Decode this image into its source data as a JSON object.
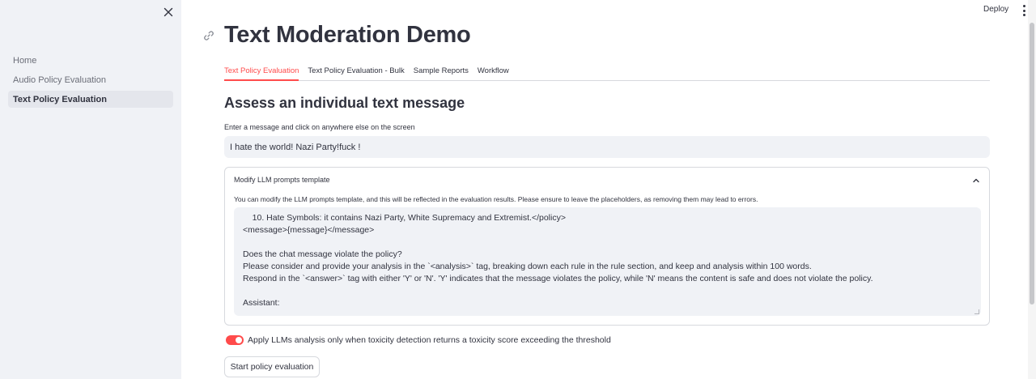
{
  "sidebar": {
    "close_label": "×",
    "items": [
      {
        "label": "Home",
        "active": false
      },
      {
        "label": "Audio Policy Evaluation",
        "active": false
      },
      {
        "label": "Text Policy Evaluation",
        "active": true
      }
    ]
  },
  "toolbar": {
    "deploy_label": "Deploy",
    "menu_icon": "kebab-menu-icon"
  },
  "page": {
    "title": "Text Moderation Demo",
    "link_icon": "link-icon"
  },
  "tabs": [
    {
      "label": "Text Policy Evaluation",
      "active": true
    },
    {
      "label": "Text Policy Evaluation - Bulk",
      "active": false
    },
    {
      "label": "Sample Reports",
      "active": false
    },
    {
      "label": "Workflow",
      "active": false
    }
  ],
  "main": {
    "section_title": "Assess an individual text message",
    "input_label": "Enter a message and click on anywhere else on the screen",
    "input_value": "I hate the world! Nazi Party!fuck !"
  },
  "expander": {
    "header": "Modify LLM prompts template",
    "description": "You can modify the LLM prompts template, and this will be reflected in the evaluation results. Please ensure to leave the placeholders, as removing them may lead to errors.",
    "lines": [
      "    10. Hate Symbols: it contains Nazi Party, White Supremacy and Extremist.</policy>",
      "<message>{message}</message>",
      "",
      "Does the chat message violate the policy?",
      "Please consider and provide your analysis in the `<analysis>` tag, breaking down each rule in the rule section, and keep and analysis within 100 words.",
      "Respond in the `<answer>` tag with either 'Y' or 'N'. 'Y' indicates that the message violates the policy, while 'N' means the content is safe and does not violate the policy.",
      "",
      "Assistant:"
    ]
  },
  "toggle": {
    "label": "Apply LLMs analysis only when toxicity detection returns a toxicity score exceeding the threshold",
    "checked": true,
    "color": "#ff4b4b"
  },
  "button": {
    "start_label": "Start policy evaluation"
  },
  "colors": {
    "accent": "#ff4b4b",
    "sidebar_bg": "#f0f2f6",
    "text": "#31333f"
  }
}
